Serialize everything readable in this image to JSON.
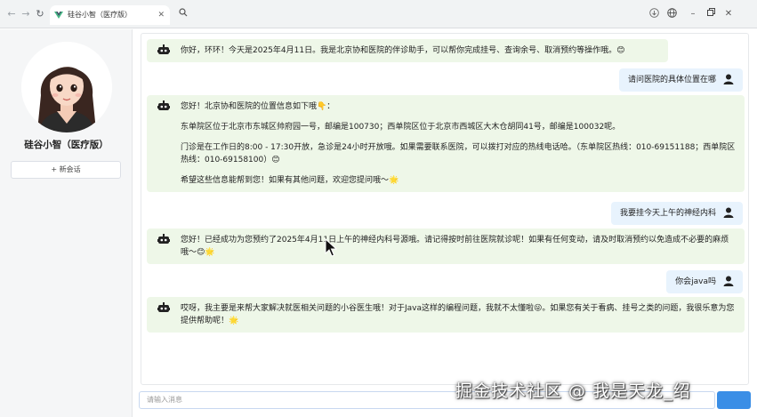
{
  "browser": {
    "tab_title": "硅谷小智（医疗版）"
  },
  "sidebar": {
    "title": "硅谷小智（医疗版）",
    "new_chat_label": "+ 新会话"
  },
  "messages": [
    {
      "role": "bot",
      "paragraphs": [
        "你好，环环！今天是2025年4月11日。我是北京协和医院的伴诊助手，可以帮你完成挂号、查询余号、取消预约等操作哦。😊"
      ]
    },
    {
      "role": "user",
      "text": "请问医院的具体位置在哪"
    },
    {
      "role": "bot",
      "paragraphs": [
        "您好！北京协和医院的位置信息如下哦👇：",
        "东单院区位于北京市东城区帅府园一号，邮编是100730；西单院区位于北京市西城区大木仓胡同41号，邮编是100032呢。",
        "门诊是在工作日的8:00 - 17:30开放，急诊是24小时开放哦。如果需要联系医院，可以拨打对应的热线电话哈。（东单院区热线：010-69151188；西单院区热线：010-69158100）😊",
        "希望这些信息能帮到您！如果有其他问题，欢迎您提问哦～🌟"
      ]
    },
    {
      "role": "user",
      "text": "我要挂今天上午的神经内科"
    },
    {
      "role": "bot",
      "paragraphs": [
        "您好！已经成功为您预约了2025年4月11日上午的神经内科号源哦。请记得按时前往医院就诊呢！如果有任何变动，请及时取消预约以免造成不必要的麻烦哦～😊🌟"
      ]
    },
    {
      "role": "user",
      "text": "你会java吗"
    },
    {
      "role": "bot",
      "paragraphs": [
        "哎呀，我主要是来帮大家解决就医相关问题的小谷医生哦！对于Java这样的编程问题，我就不太懂啦😜。如果您有关于看病、挂号之类的问题，我很乐意为您提供帮助呢！🌟"
      ]
    }
  ],
  "input": {
    "placeholder": "请输入消息"
  },
  "watermark": "掘金技术社区 @ 我是天龙_绍",
  "colors": {
    "bot_bubble": "#eef7e8",
    "user_bubble": "#e8f3fd",
    "send_button": "#3a8ee6"
  }
}
